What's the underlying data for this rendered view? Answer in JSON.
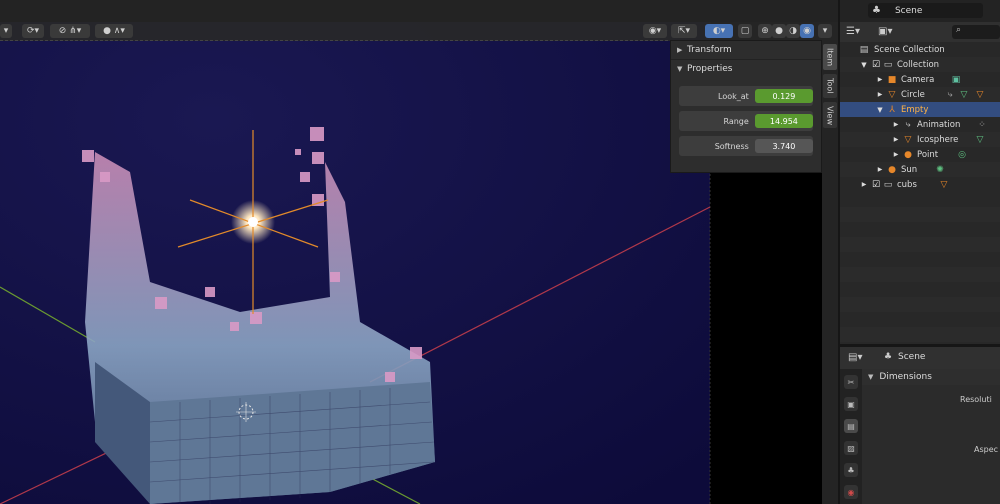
{
  "topbar": {
    "scene_label": "Scene"
  },
  "npanel": {
    "transform_label": "Transform",
    "properties_label": "Properties",
    "props": [
      {
        "label": "Look_at",
        "value": "0.129",
        "style": "green"
      },
      {
        "label": "Range",
        "value": "14.954",
        "style": "green"
      },
      {
        "label": "Softness",
        "value": "3.740",
        "style": "grey"
      }
    ],
    "tabs": [
      "Item",
      "Tool",
      "View"
    ]
  },
  "outliner": {
    "rows": [
      {
        "label": "Scene Collection",
        "indent": 0
      },
      {
        "label": "Collection",
        "indent": 1
      },
      {
        "label": "Camera",
        "indent": 2
      },
      {
        "label": "Circle",
        "indent": 2
      },
      {
        "label": "Empty",
        "indent": 2
      },
      {
        "label": "Animation",
        "indent": 3
      },
      {
        "label": "Icosphere",
        "indent": 3
      },
      {
        "label": "Point",
        "indent": 3
      },
      {
        "label": "Sun",
        "indent": 2
      },
      {
        "label": "cubs",
        "indent": 1
      }
    ]
  },
  "properties": {
    "scene_label": "Scene",
    "section_label": "Dimensions",
    "field_resolution": "Resoluti",
    "field_aspect": "Aspec"
  },
  "colors": {
    "accent": "#4772b3",
    "green_field": "#5a9a2f",
    "selected_row": "#334d80"
  }
}
